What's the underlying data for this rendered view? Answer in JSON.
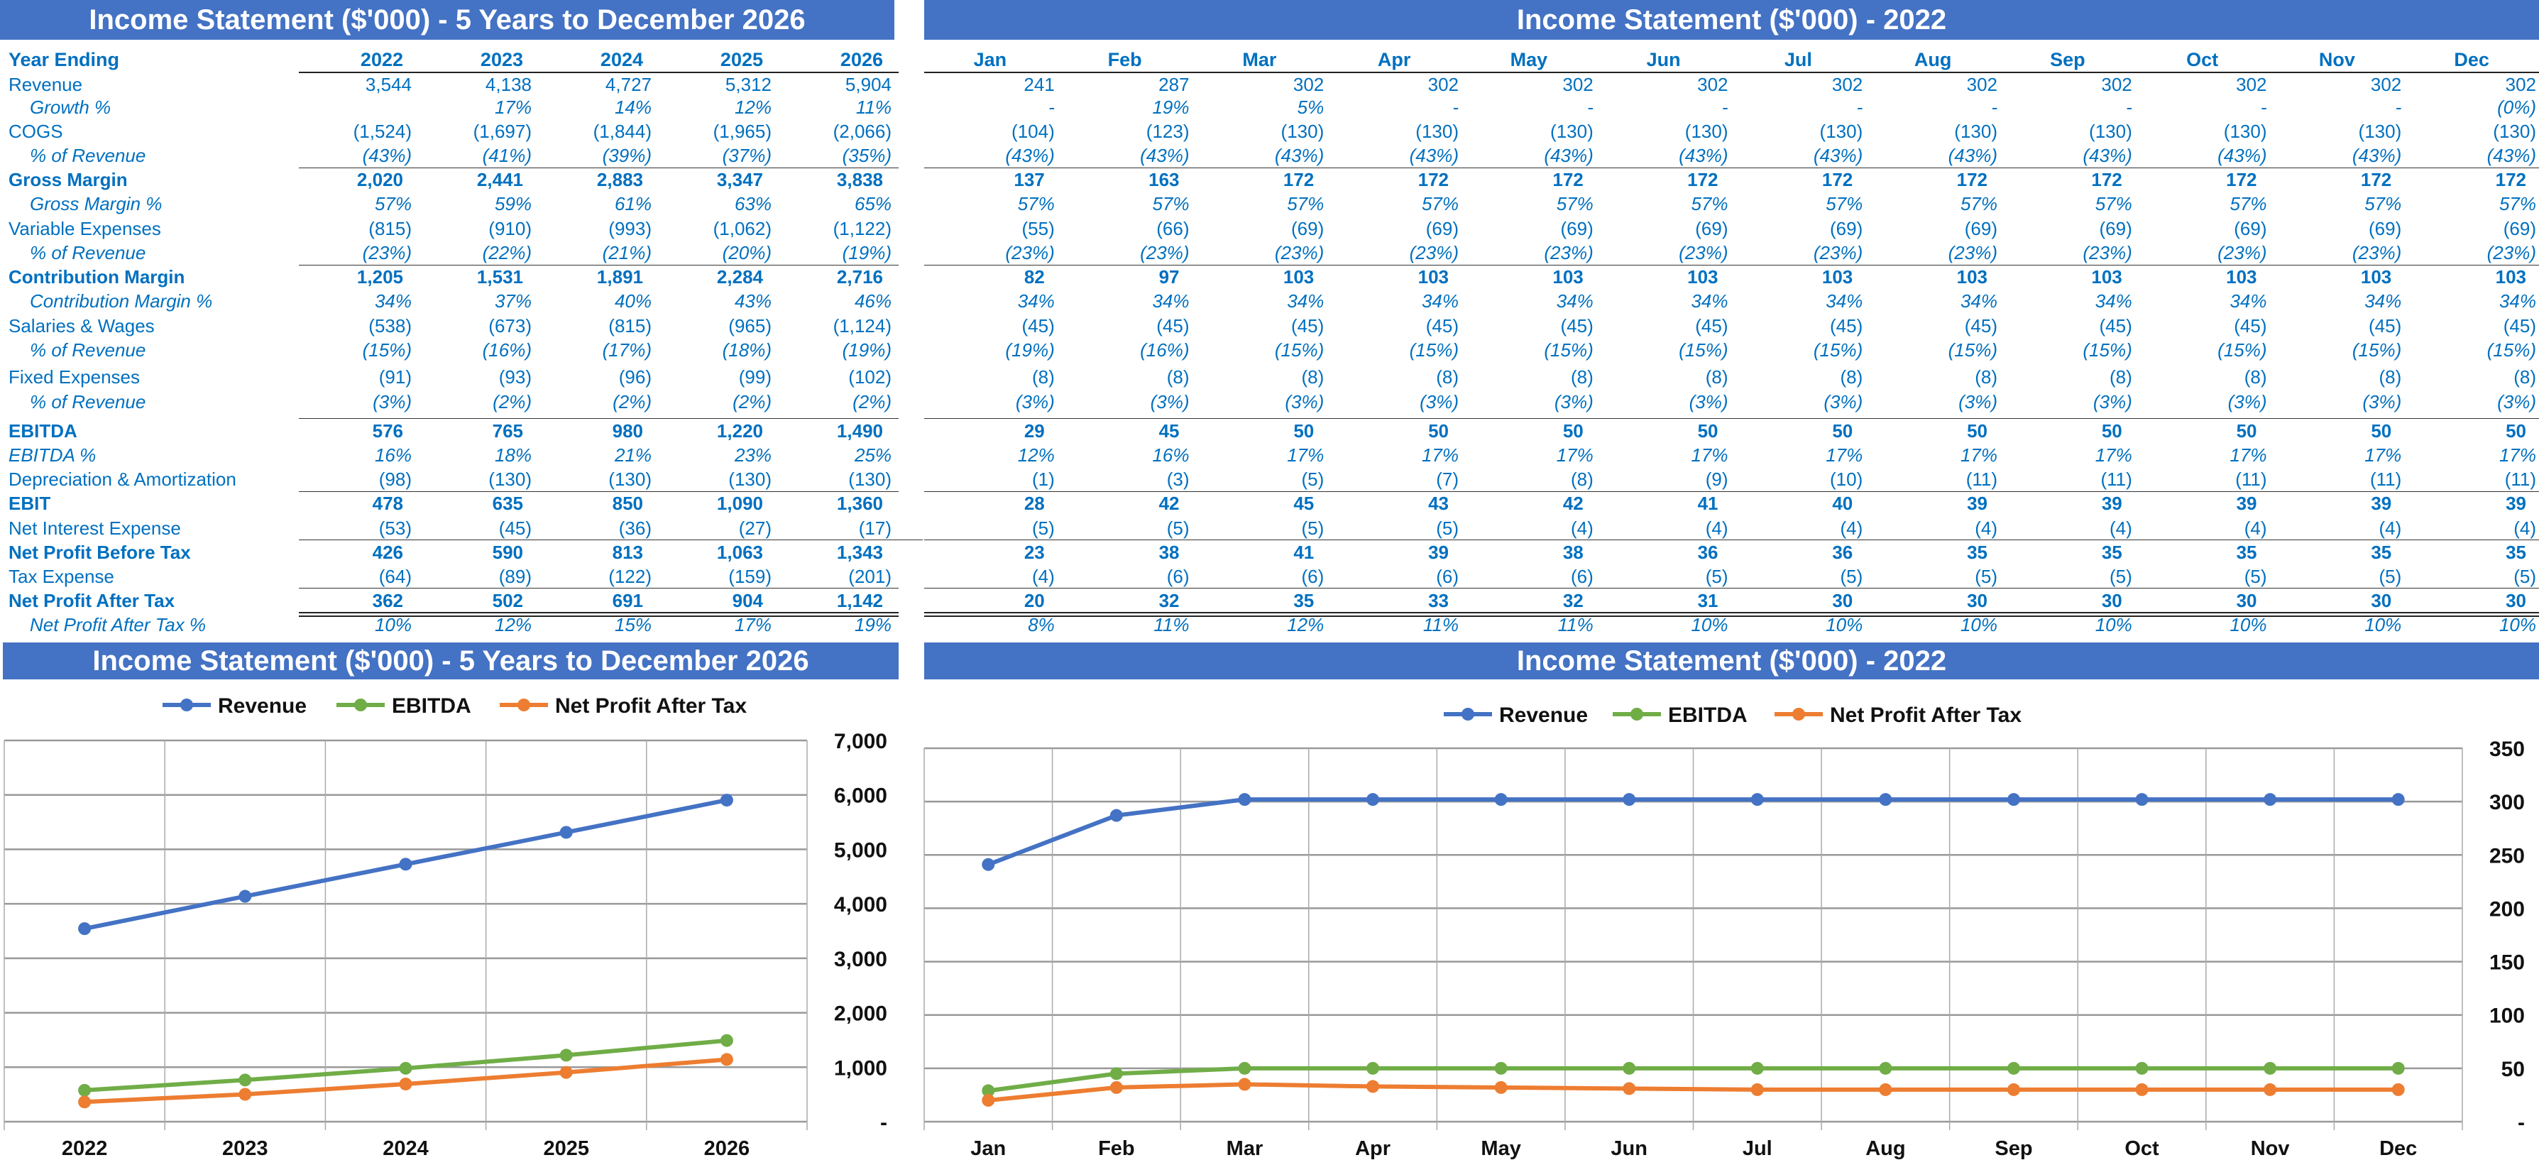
{
  "titles": {
    "annual_table": "Income Statement ($'000) - 5 Years to December 2026",
    "monthly_table": "Income Statement ($'000) - 2022",
    "annual_chart": "Income Statement ($'000) - 5 Years to December 2026",
    "monthly_chart": "Income Statement ($'000) - 2022"
  },
  "colors": {
    "title_bar": "#4472C4",
    "text": "#0070C0",
    "revenue": "#4472C4",
    "ebitda": "#70AD47",
    "npat": "#ED7D31"
  },
  "table": {
    "header_label": "Year Ending",
    "years": [
      "2022",
      "2023",
      "2024",
      "2025",
      "2026"
    ],
    "months": [
      "Jan",
      "Feb",
      "Mar",
      "Apr",
      "May",
      "Jun",
      "Jul",
      "Aug",
      "Sep",
      "Oct",
      "Nov",
      "Dec"
    ],
    "rows": [
      {
        "label": "Revenue",
        "style": "normal",
        "annual": [
          "3,544",
          "4,138",
          "4,727",
          "5,312",
          "5,904"
        ],
        "monthly": [
          "241",
          "287",
          "302",
          "302",
          "302",
          "302",
          "302",
          "302",
          "302",
          "302",
          "302",
          "302"
        ]
      },
      {
        "label": "Growth %",
        "style": "sub",
        "annual": [
          "",
          "17%",
          "14%",
          "12%",
          "11%"
        ],
        "monthly": [
          "-",
          "19%",
          "5%",
          "-",
          "-",
          "-",
          "-",
          "-",
          "-",
          "-",
          "-",
          "(0%)"
        ]
      },
      {
        "label": "COGS",
        "style": "normal",
        "annual": [
          "(1,524)",
          "(1,697)",
          "(1,844)",
          "(1,965)",
          "(2,066)"
        ],
        "monthly": [
          "(104)",
          "(123)",
          "(130)",
          "(130)",
          "(130)",
          "(130)",
          "(130)",
          "(130)",
          "(130)",
          "(130)",
          "(130)",
          "(130)"
        ]
      },
      {
        "label": "% of Revenue",
        "style": "sub",
        "annual": [
          "(43%)",
          "(41%)",
          "(39%)",
          "(37%)",
          "(35%)"
        ],
        "monthly": [
          "(43%)",
          "(43%)",
          "(43%)",
          "(43%)",
          "(43%)",
          "(43%)",
          "(43%)",
          "(43%)",
          "(43%)",
          "(43%)",
          "(43%)",
          "(43%)"
        ]
      },
      {
        "label": "Gross Margin",
        "style": "bold",
        "annual": [
          "2,020",
          "2,441",
          "2,883",
          "3,347",
          "3,838"
        ],
        "monthly": [
          "137",
          "163",
          "172",
          "172",
          "172",
          "172",
          "172",
          "172",
          "172",
          "172",
          "172",
          "172"
        ]
      },
      {
        "label": "Gross Margin %",
        "style": "sub",
        "annual": [
          "57%",
          "59%",
          "61%",
          "63%",
          "65%"
        ],
        "monthly": [
          "57%",
          "57%",
          "57%",
          "57%",
          "57%",
          "57%",
          "57%",
          "57%",
          "57%",
          "57%",
          "57%",
          "57%"
        ]
      },
      {
        "label": "Variable Expenses",
        "style": "normal",
        "annual": [
          "(815)",
          "(910)",
          "(993)",
          "(1,062)",
          "(1,122)"
        ],
        "monthly": [
          "(55)",
          "(66)",
          "(69)",
          "(69)",
          "(69)",
          "(69)",
          "(69)",
          "(69)",
          "(69)",
          "(69)",
          "(69)",
          "(69)"
        ]
      },
      {
        "label": "% of Revenue",
        "style": "sub",
        "annual": [
          "(23%)",
          "(22%)",
          "(21%)",
          "(20%)",
          "(19%)"
        ],
        "monthly": [
          "(23%)",
          "(23%)",
          "(23%)",
          "(23%)",
          "(23%)",
          "(23%)",
          "(23%)",
          "(23%)",
          "(23%)",
          "(23%)",
          "(23%)",
          "(23%)"
        ]
      },
      {
        "label": "Contribution Margin",
        "style": "bold",
        "annual": [
          "1,205",
          "1,531",
          "1,891",
          "2,284",
          "2,716"
        ],
        "monthly": [
          "82",
          "97",
          "103",
          "103",
          "103",
          "103",
          "103",
          "103",
          "103",
          "103",
          "103",
          "103"
        ]
      },
      {
        "label": "Contribution Margin %",
        "style": "sub",
        "annual": [
          "34%",
          "37%",
          "40%",
          "43%",
          "46%"
        ],
        "monthly": [
          "34%",
          "34%",
          "34%",
          "34%",
          "34%",
          "34%",
          "34%",
          "34%",
          "34%",
          "34%",
          "34%",
          "34%"
        ]
      },
      {
        "label": "Salaries & Wages",
        "style": "normal",
        "annual": [
          "(538)",
          "(673)",
          "(815)",
          "(965)",
          "(1,124)"
        ],
        "monthly": [
          "(45)",
          "(45)",
          "(45)",
          "(45)",
          "(45)",
          "(45)",
          "(45)",
          "(45)",
          "(45)",
          "(45)",
          "(45)",
          "(45)"
        ]
      },
      {
        "label": "% of Revenue",
        "style": "sub",
        "annual": [
          "(15%)",
          "(16%)",
          "(17%)",
          "(18%)",
          "(19%)"
        ],
        "monthly": [
          "(19%)",
          "(16%)",
          "(15%)",
          "(15%)",
          "(15%)",
          "(15%)",
          "(15%)",
          "(15%)",
          "(15%)",
          "(15%)",
          "(15%)",
          "(15%)"
        ]
      },
      {
        "label": "Fixed Expenses",
        "style": "normal",
        "annual": [
          "(91)",
          "(93)",
          "(96)",
          "(99)",
          "(102)"
        ],
        "monthly": [
          "(8)",
          "(8)",
          "(8)",
          "(8)",
          "(8)",
          "(8)",
          "(8)",
          "(8)",
          "(8)",
          "(8)",
          "(8)",
          "(8)"
        ]
      },
      {
        "label": "% of Revenue",
        "style": "sub",
        "annual": [
          "(3%)",
          "(2%)",
          "(2%)",
          "(2%)",
          "(2%)"
        ],
        "monthly": [
          "(3%)",
          "(3%)",
          "(3%)",
          "(3%)",
          "(3%)",
          "(3%)",
          "(3%)",
          "(3%)",
          "(3%)",
          "(3%)",
          "(3%)",
          "(3%)"
        ]
      },
      {
        "label": "EBITDA",
        "style": "bold",
        "annual": [
          "576",
          "765",
          "980",
          "1,220",
          "1,490"
        ],
        "monthly": [
          "29",
          "45",
          "50",
          "50",
          "50",
          "50",
          "50",
          "50",
          "50",
          "50",
          "50",
          "50"
        ]
      },
      {
        "label": "EBITDA %",
        "style": "italic",
        "annual": [
          "16%",
          "18%",
          "21%",
          "23%",
          "25%"
        ],
        "monthly": [
          "12%",
          "16%",
          "17%",
          "17%",
          "17%",
          "17%",
          "17%",
          "17%",
          "17%",
          "17%",
          "17%",
          "17%"
        ]
      },
      {
        "label": "Depreciation & Amortization",
        "style": "normal",
        "annual": [
          "(98)",
          "(130)",
          "(130)",
          "(130)",
          "(130)"
        ],
        "monthly": [
          "(1)",
          "(3)",
          "(5)",
          "(7)",
          "(8)",
          "(9)",
          "(10)",
          "(11)",
          "(11)",
          "(11)",
          "(11)",
          "(11)"
        ]
      },
      {
        "label": "EBIT",
        "style": "bold",
        "annual": [
          "478",
          "635",
          "850",
          "1,090",
          "1,360"
        ],
        "monthly": [
          "28",
          "42",
          "45",
          "43",
          "42",
          "41",
          "40",
          "39",
          "39",
          "39",
          "39",
          "39"
        ]
      },
      {
        "label": "Net Interest Expense",
        "style": "normal",
        "annual": [
          "(53)",
          "(45)",
          "(36)",
          "(27)",
          "(17)"
        ],
        "monthly": [
          "(5)",
          "(5)",
          "(5)",
          "(5)",
          "(4)",
          "(4)",
          "(4)",
          "(4)",
          "(4)",
          "(4)",
          "(4)",
          "(4)"
        ]
      },
      {
        "label": "Net Profit Before Tax",
        "style": "bold",
        "annual": [
          "426",
          "590",
          "813",
          "1,063",
          "1,343"
        ],
        "monthly": [
          "23",
          "38",
          "41",
          "39",
          "38",
          "36",
          "36",
          "35",
          "35",
          "35",
          "35",
          "35"
        ]
      },
      {
        "label": "Tax Expense",
        "style": "normal",
        "annual": [
          "(64)",
          "(89)",
          "(122)",
          "(159)",
          "(201)"
        ],
        "monthly": [
          "(4)",
          "(6)",
          "(6)",
          "(6)",
          "(6)",
          "(5)",
          "(5)",
          "(5)",
          "(5)",
          "(5)",
          "(5)",
          "(5)"
        ]
      },
      {
        "label": "Net Profit After Tax",
        "style": "bold",
        "annual": [
          "362",
          "502",
          "691",
          "904",
          "1,142"
        ],
        "monthly": [
          "20",
          "32",
          "35",
          "33",
          "32",
          "31",
          "30",
          "30",
          "30",
          "30",
          "30",
          "30"
        ]
      },
      {
        "label": "Net Profit After Tax %",
        "style": "sub",
        "annual": [
          "10%",
          "12%",
          "15%",
          "17%",
          "19%"
        ],
        "monthly": [
          "8%",
          "11%",
          "12%",
          "11%",
          "11%",
          "10%",
          "10%",
          "10%",
          "10%",
          "10%",
          "10%",
          "10%"
        ]
      }
    ]
  },
  "chart_data": [
    {
      "type": "line",
      "title": "Income Statement ($'000) - 5 Years to December 2026",
      "categories": [
        "2022",
        "2023",
        "2024",
        "2025",
        "2026"
      ],
      "series": [
        {
          "name": "Revenue",
          "values": [
            3544,
            4138,
            4727,
            5312,
            5904
          ],
          "color": "#4472C4"
        },
        {
          "name": "EBITDA",
          "values": [
            576,
            765,
            980,
            1220,
            1490
          ],
          "color": "#70AD47"
        },
        {
          "name": "Net Profit After Tax",
          "values": [
            362,
            502,
            691,
            904,
            1142
          ],
          "color": "#ED7D31"
        }
      ],
      "ylim": [
        0,
        7000
      ],
      "yticks": [
        "-",
        "1,000",
        "2,000",
        "3,000",
        "4,000",
        "5,000",
        "6,000",
        "7,000"
      ],
      "y_axis_side": "right",
      "grid": true,
      "legend": "top"
    },
    {
      "type": "line",
      "title": "Income Statement ($'000) - 2022",
      "categories": [
        "Jan",
        "Feb",
        "Mar",
        "Apr",
        "May",
        "Jun",
        "Jul",
        "Aug",
        "Sep",
        "Oct",
        "Nov",
        "Dec"
      ],
      "series": [
        {
          "name": "Revenue",
          "values": [
            241,
            287,
            302,
            302,
            302,
            302,
            302,
            302,
            302,
            302,
            302,
            302
          ],
          "color": "#4472C4"
        },
        {
          "name": "EBITDA",
          "values": [
            29,
            45,
            50,
            50,
            50,
            50,
            50,
            50,
            50,
            50,
            50,
            50
          ],
          "color": "#70AD47"
        },
        {
          "name": "Net Profit After Tax",
          "values": [
            20,
            32,
            35,
            33,
            32,
            31,
            30,
            30,
            30,
            30,
            30,
            30
          ],
          "color": "#ED7D31"
        }
      ],
      "ylim": [
        0,
        350
      ],
      "yticks": [
        "-",
        "50",
        "100",
        "150",
        "200",
        "250",
        "300",
        "350"
      ],
      "y_axis_side": "right",
      "grid": true,
      "legend": "top"
    }
  ]
}
